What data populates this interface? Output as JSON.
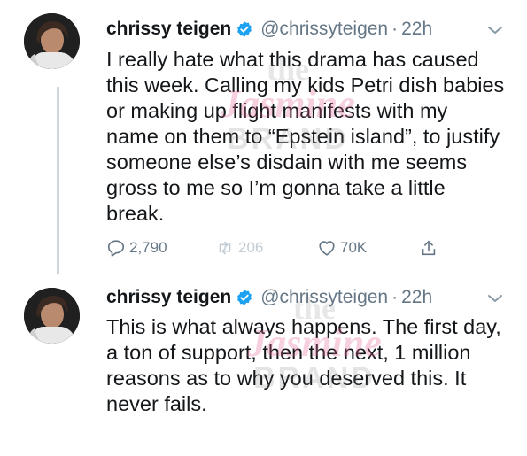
{
  "tweets": [
    {
      "name": "chrissy teigen",
      "handle": "@chrissyteigen",
      "separator": "·",
      "time": "22h",
      "lines": [
        "I really hate what this drama has caused",
        "this week. Calling my kids Petri dish babies",
        "or making up flight manifests with my",
        "name on them to “Epstein island”, to justify",
        "someone else’s disdain with me seems",
        "gross to me so I’m gonna take a little",
        "break."
      ],
      "replies": "2,790",
      "retweets": "206",
      "likes": "70K"
    },
    {
      "name": "chrissy teigen",
      "handle": "@chrissyteigen",
      "separator": "·",
      "time": "22h",
      "lines": [
        "This is what always happens. The first day,",
        "a ton of support, then the next, 1 million",
        "reasons as to why you deserved this. It",
        "never fails."
      ]
    }
  ],
  "watermark": {
    "line1": "the",
    "line2": "Jasmine",
    "line3": "BRAND"
  },
  "icons": {
    "verified": "verified-badge-icon",
    "chevron": "chevron-down-icon",
    "reply": "reply-icon",
    "retweet": "retweet-icon",
    "like": "heart-icon",
    "share": "share-icon"
  },
  "colors": {
    "verified": "#1da1f2",
    "secondary_text": "#657786",
    "thread_line": "#ccd6dd"
  }
}
